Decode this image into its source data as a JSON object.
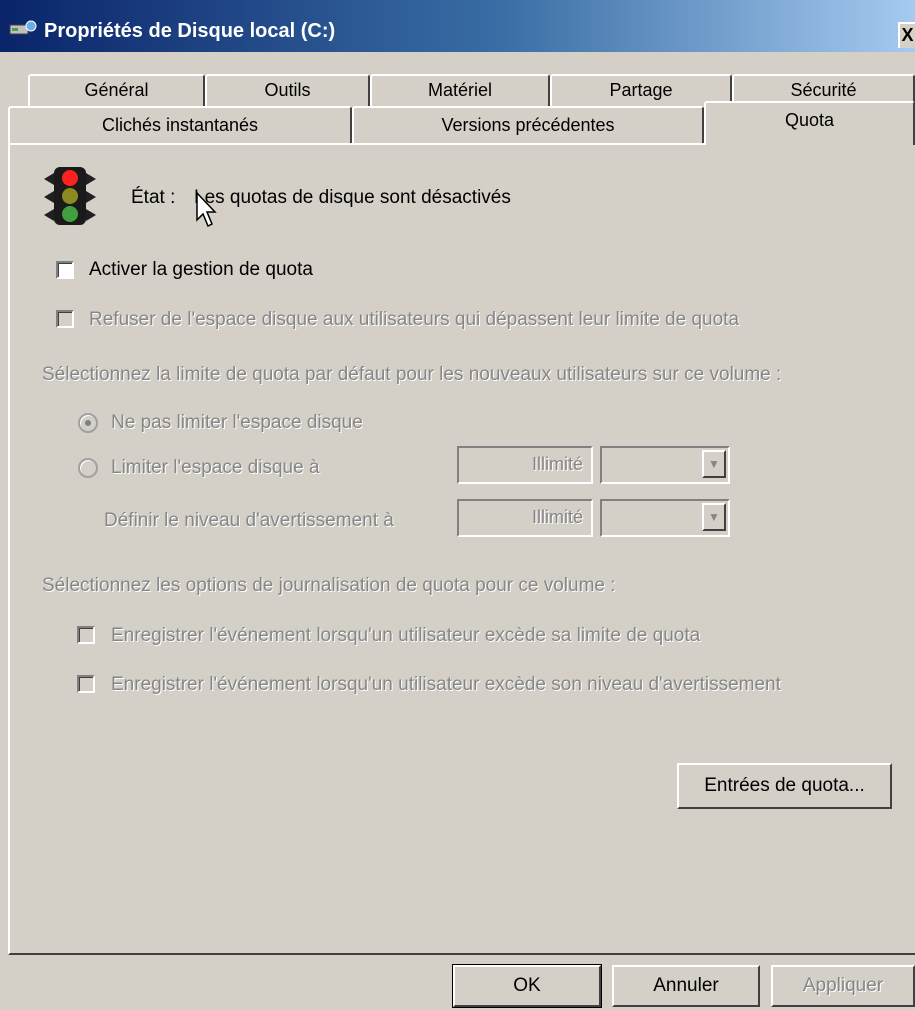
{
  "window": {
    "title": "Propriétés de Disque local (C:)",
    "close_glyph": "X"
  },
  "tabs_row1": [
    "Général",
    "Outils",
    "Matériel",
    "Partage",
    "Sécurité"
  ],
  "tabs_row2": [
    "Clichés instantanés",
    "Versions précédentes",
    "Quota"
  ],
  "active_tab": "Quota",
  "status": {
    "label": "État :",
    "text": "Les quotas de disque sont désactivés",
    "icon": "traffic-light-icon"
  },
  "quota": {
    "enable_label": "Activer la gestion de quota",
    "enable_checked": false,
    "deny_label": "Refuser de l'espace disque aux utilisateurs qui dépassent leur limite de quota",
    "deny_checked": false,
    "default_limit_heading": "Sélectionnez la limite de quota par défaut pour les nouveaux utilisateurs sur ce volume :",
    "no_limit_label": "Ne pas limiter l'espace disque",
    "limit_label": "Limiter l'espace disque à",
    "limit_value": "Illimité",
    "warning_label": "Définir le niveau d'avertissement à",
    "warning_value": "Illimité",
    "selected_option": "no_limit"
  },
  "logging": {
    "heading": "Sélectionnez les options de journalisation de quota pour ce volume :",
    "log_limit_label": "Enregistrer l'événement lorsqu'un utilisateur excède sa limite de quota",
    "log_warning_label": "Enregistrer l'événement lorsqu'un utilisateur excède son niveau d'avertissement"
  },
  "entries_button": "Entrées de quota...",
  "footer": {
    "ok": "OK",
    "cancel": "Annuler",
    "apply": "Appliquer"
  },
  "colors": {
    "face": "#d4d0c8",
    "title_start": "#0a246a",
    "title_end": "#a6caf0",
    "disabled_text": "#868686"
  }
}
